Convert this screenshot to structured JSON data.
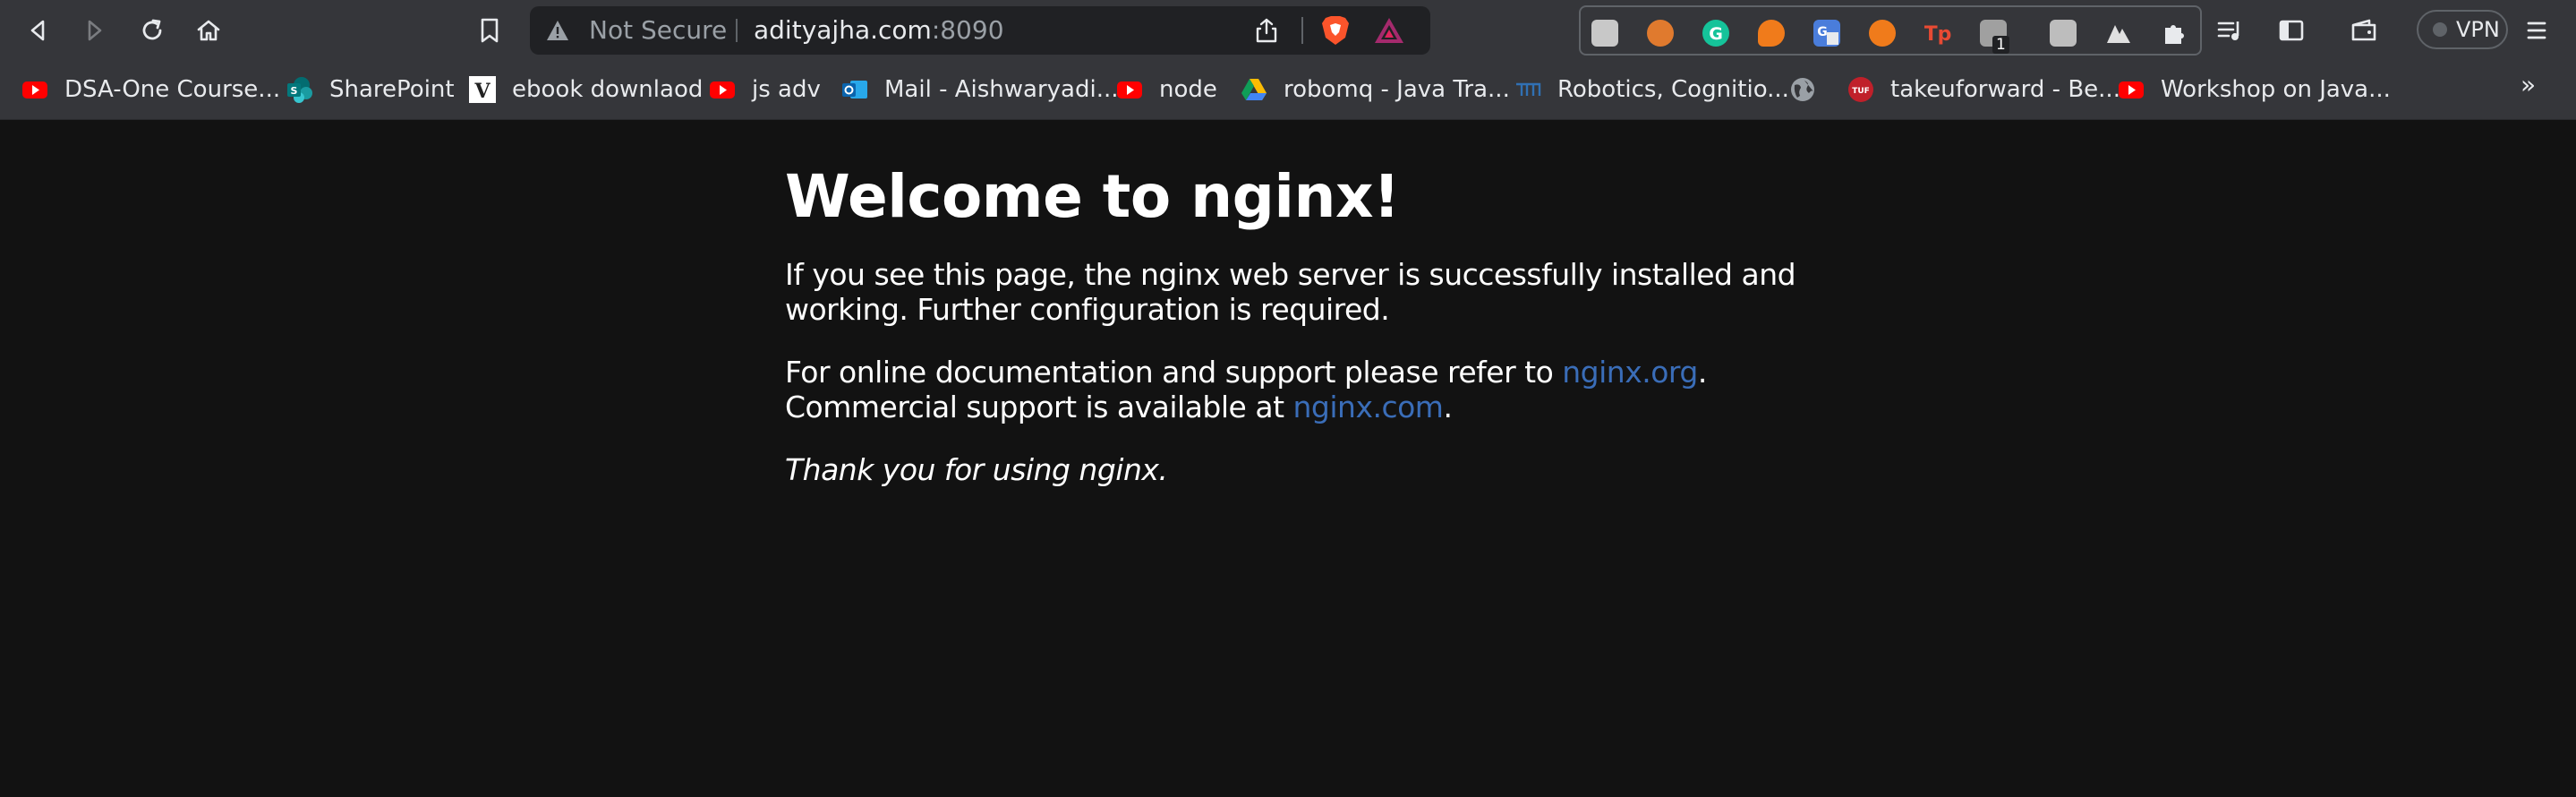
{
  "browser": {
    "url": {
      "security_label": "Not Secure",
      "host": "adityajha.com",
      "port": ":8090"
    },
    "extensions": [
      {
        "name": "extension-1",
        "color": "#c8c8c8"
      },
      {
        "name": "extension-2",
        "color": "#e07a2e"
      },
      {
        "name": "grammarly",
        "color": "#15c39a"
      },
      {
        "name": "extension-4",
        "color": "#f07b1b"
      },
      {
        "name": "google-translate",
        "color": "#4a7ddb"
      },
      {
        "name": "extension-6",
        "color": "#f07b1b"
      },
      {
        "name": "extension-7",
        "color": "#e84a33"
      },
      {
        "name": "extension-8",
        "color": "#a0a0a0",
        "badge": "1"
      },
      {
        "name": "extension-9",
        "color": "#bdbdbd"
      },
      {
        "name": "extension-10",
        "color": "#e0e0e0"
      }
    ],
    "vpn_label": "VPN"
  },
  "bookmarks": [
    {
      "label": "DSA-One Course...",
      "icon": "youtube-icon"
    },
    {
      "label": "SharePoint",
      "icon": "sharepoint-icon"
    },
    {
      "label": "ebook downlaod",
      "icon": "v-icon"
    },
    {
      "label": "js adv",
      "icon": "youtube-icon"
    },
    {
      "label": "Mail - Aishwaryadi...",
      "icon": "outlook-icon"
    },
    {
      "label": "node",
      "icon": "youtube-icon"
    },
    {
      "label": "robomq - Java Tra...",
      "icon": "google-drive-icon"
    },
    {
      "label": "Robotics, Cognitio...",
      "icon": "tum-icon"
    },
    {
      "label": "",
      "icon": "globe-icon"
    },
    {
      "label": "takeuforward - Be...",
      "icon": "tuf-icon"
    },
    {
      "label": "Workshop on Java...",
      "icon": "youtube-icon"
    }
  ],
  "bookmarks_overflow": "»",
  "page": {
    "heading": "Welcome to nginx!",
    "p1": "If you see this page, the nginx web server is successfully installed and working. Further configuration is required.",
    "p2_prefix": "For online documentation and support please refer to ",
    "p2_link1": "nginx.org",
    "p2_mid": ".",
    "p2_line2": "Commercial support is available at ",
    "p2_link2": "nginx.com",
    "p2_end": ".",
    "p3": "Thank you for using nginx."
  },
  "colors": {
    "page_background": "#121212",
    "link": "#3a6db8",
    "toolbar": "#35363a"
  }
}
